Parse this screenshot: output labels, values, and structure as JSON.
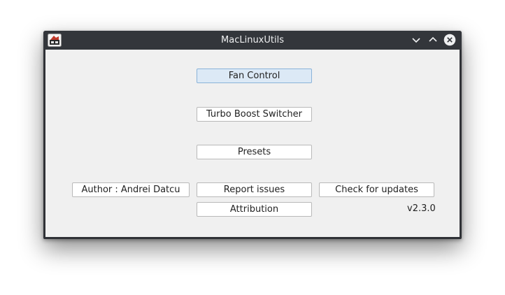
{
  "window": {
    "title": "MacLinuxUtils",
    "controls": [
      "minimize-icon",
      "maximize-icon",
      "close-icon"
    ]
  },
  "buttons": {
    "fan_control": "Fan Control",
    "turbo_boost_switcher": "Turbo Boost Switcher",
    "presets": "Presets",
    "author": "Author : Andrei Datcu",
    "report_issues": "Report issues",
    "check_for_updates": "Check for updates",
    "attribution": "Attribution"
  },
  "version": "v2.3.0",
  "colors": {
    "titlebar": "#33363b",
    "client_background": "#f0f0f0",
    "focused_button": "#dce9f6",
    "focused_border": "#8ab3d9"
  }
}
